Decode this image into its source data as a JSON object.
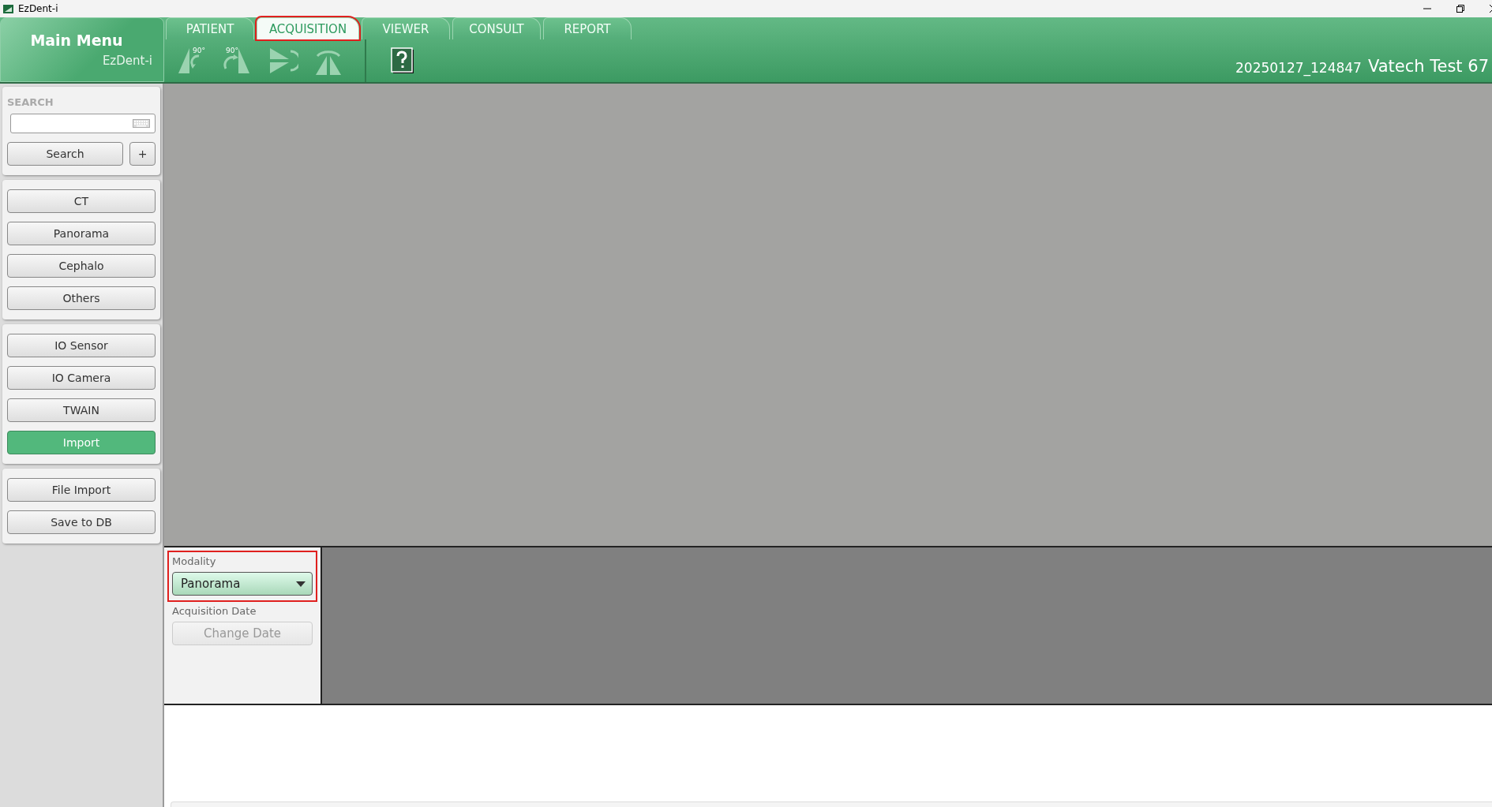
{
  "window": {
    "title": "EzDent-i"
  },
  "main_menu": {
    "title": "Main Menu",
    "subtitle": "EzDent-i"
  },
  "tabs": [
    {
      "label": "PATIENT",
      "selected": false,
      "annotated": false
    },
    {
      "label": "ACQUISITION",
      "selected": true,
      "annotated": true
    },
    {
      "label": "VIEWER",
      "selected": false,
      "annotated": false
    },
    {
      "label": "CONSULT",
      "selected": false,
      "annotated": false
    },
    {
      "label": "REPORT",
      "selected": false,
      "annotated": false
    }
  ],
  "toolbar": [
    {
      "kind": "rotate-left",
      "label": "90°",
      "disabled": true
    },
    {
      "kind": "rotate-right",
      "label": "90°",
      "disabled": true
    },
    {
      "kind": "flip-horizontal",
      "disabled": true
    },
    {
      "kind": "flip-vertical",
      "disabled": true
    },
    {
      "kind": "help",
      "disabled": false
    }
  ],
  "patient": {
    "id": "20250127_124847",
    "name": "Vatech Test 67"
  },
  "search": {
    "label": "SEARCH",
    "button": "Search",
    "add_button": "+"
  },
  "sidebar": {
    "groups": [
      [
        {
          "label": "CT",
          "selected": false
        },
        {
          "label": "Panorama",
          "selected": false
        },
        {
          "label": "Cephalo",
          "selected": false
        },
        {
          "label": "Others",
          "selected": false
        }
      ],
      [
        {
          "label": "IO Sensor",
          "selected": false
        },
        {
          "label": "IO Camera",
          "selected": false
        },
        {
          "label": "TWAIN",
          "selected": false
        },
        {
          "label": "Import",
          "selected": true
        }
      ],
      [
        {
          "label": "File Import",
          "selected": false
        },
        {
          "label": "Save to DB",
          "selected": false
        }
      ]
    ]
  },
  "properties": {
    "modality_label": "Modality",
    "modality": "Panorama",
    "modality_annotated": true,
    "date_label": "Acquisition Date",
    "change_date": {
      "label": "Change Date",
      "disabled": true
    }
  }
}
